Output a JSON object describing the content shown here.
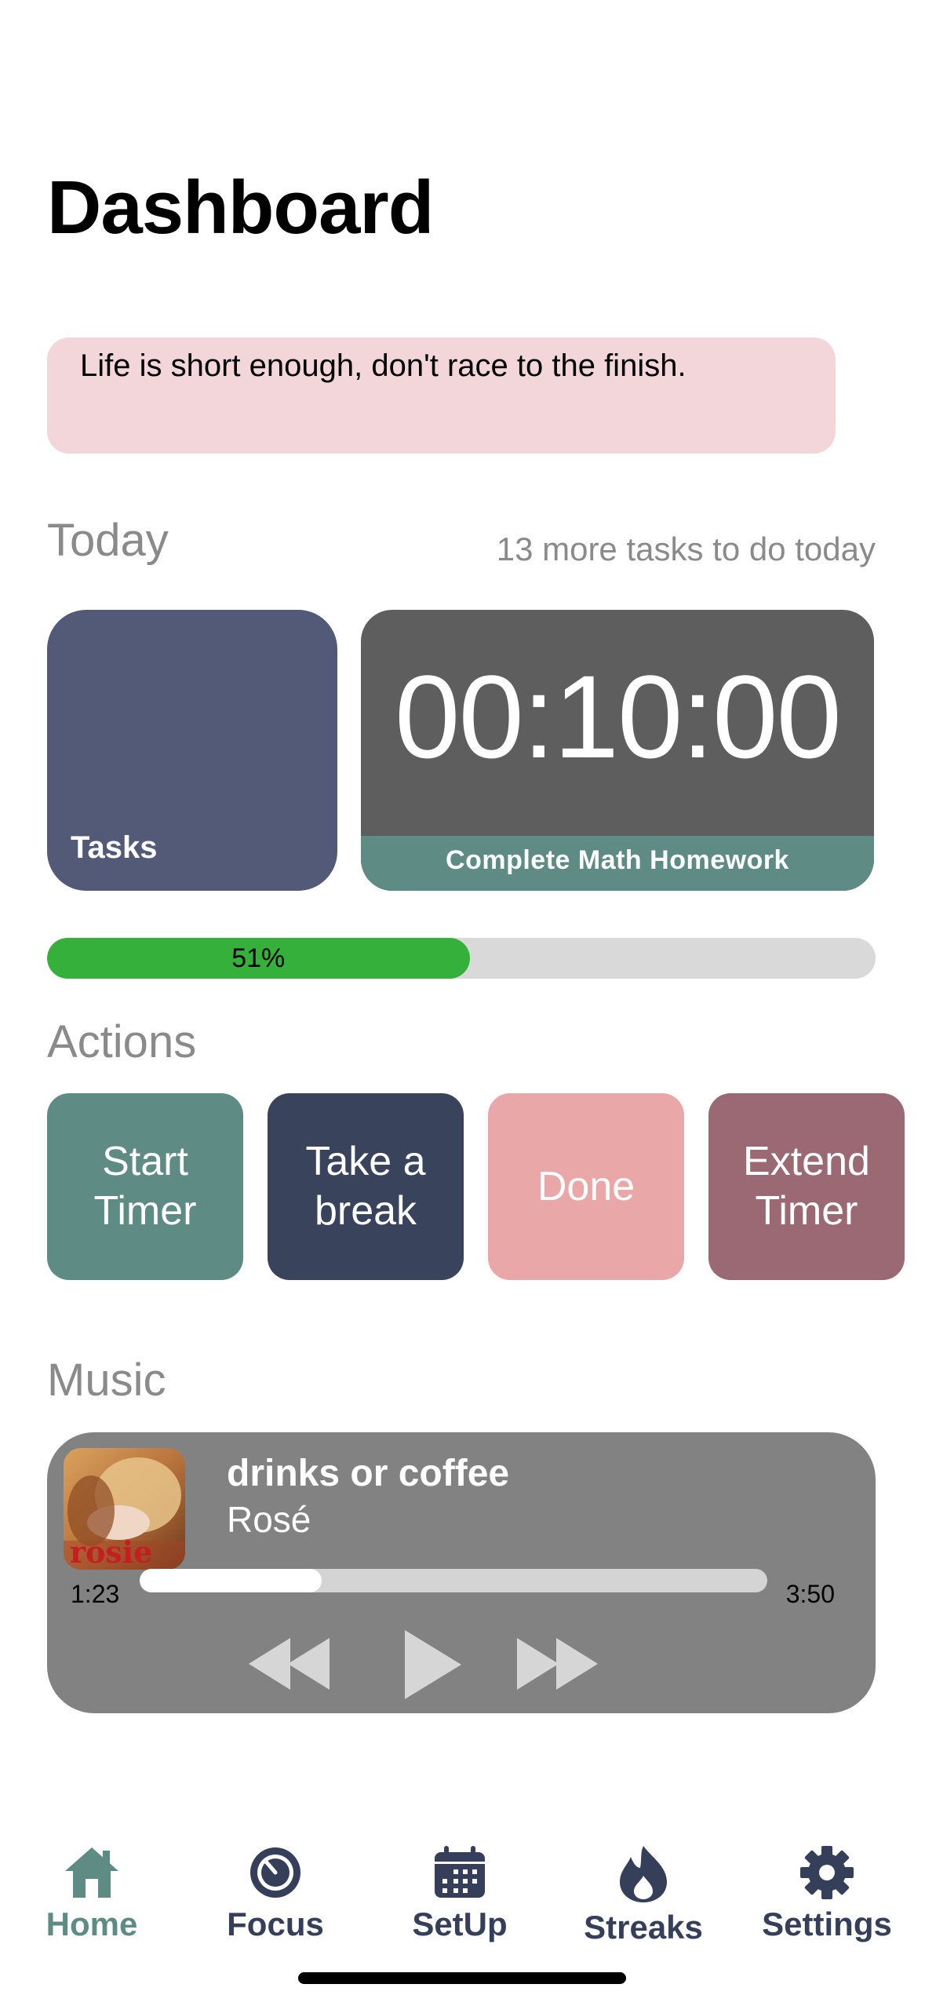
{
  "page": {
    "title": "Dashboard"
  },
  "quote": {
    "text": "Life is short enough, don't race to the finish."
  },
  "today": {
    "section_label": "Today",
    "tasks_remaining": "13 more tasks to do today",
    "tasks_tile_label": "Tasks",
    "timer_display": "00:10:00",
    "current_task": "Complete Math Homework",
    "progress_percent": 51,
    "progress_label": "51%"
  },
  "actions": {
    "section_label": "Actions",
    "buttons": [
      {
        "label": "Start Timer",
        "color": "#5f8b85"
      },
      {
        "label": "Take a break",
        "color": "#39435c"
      },
      {
        "label": "Done",
        "color": "#e9a7a8"
      },
      {
        "label": "Extend Timer",
        "color": "#9a6974"
      }
    ]
  },
  "music": {
    "section_label": "Music",
    "track_title": "drinks or coffee",
    "artist": "Rosé",
    "album_art_text": "rosie",
    "elapsed": "1:23",
    "duration": "3:50",
    "progress_fraction": 0.29,
    "controls": [
      "rewind-icon",
      "play-icon",
      "fast-forward-icon"
    ]
  },
  "tab_bar": {
    "items": [
      {
        "label": "Home",
        "icon": "home-icon",
        "active": true
      },
      {
        "label": "Focus",
        "icon": "focus-gauge-icon",
        "active": false
      },
      {
        "label": "SetUp",
        "icon": "calendar-icon",
        "active": false
      },
      {
        "label": "Streaks",
        "icon": "flame-icon",
        "active": false
      },
      {
        "label": "Settings",
        "icon": "gear-icon",
        "active": false
      }
    ]
  },
  "colors": {
    "accent": "#5f8b85",
    "nav": "#353f5a",
    "quote_bg": "#f3d6d9",
    "progress": "#35b03a"
  }
}
